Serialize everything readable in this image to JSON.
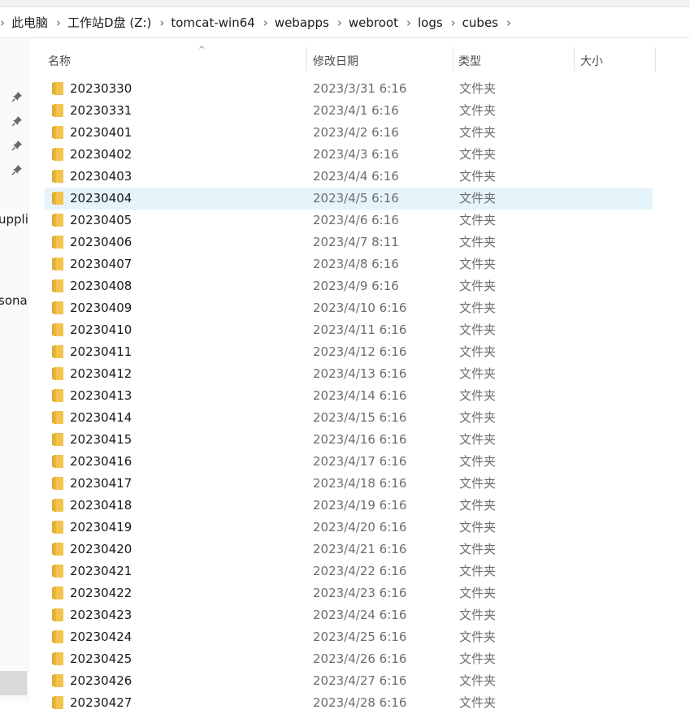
{
  "breadcrumb": [
    "此电脑",
    "工作站D盘 (Z:)",
    "tomcat-win64",
    "webapps",
    "webroot",
    "logs",
    "cubes"
  ],
  "nav_fragments": [
    "upplic",
    "sona"
  ],
  "columns": {
    "name": "名称",
    "modified": "修改日期",
    "type": "类型",
    "size": "大小"
  },
  "colors": {
    "selected_row": "#e5f3fb",
    "folder": "#f2c44e",
    "folder_dark": "#dfa92c"
  },
  "selected_index": 5,
  "files": [
    {
      "name": "20230330",
      "date": "2023/3/31 6:16",
      "type": "文件夹"
    },
    {
      "name": "20230331",
      "date": "2023/4/1 6:16",
      "type": "文件夹"
    },
    {
      "name": "20230401",
      "date": "2023/4/2 6:16",
      "type": "文件夹"
    },
    {
      "name": "20230402",
      "date": "2023/4/3 6:16",
      "type": "文件夹"
    },
    {
      "name": "20230403",
      "date": "2023/4/4 6:16",
      "type": "文件夹"
    },
    {
      "name": "20230404",
      "date": "2023/4/5 6:16",
      "type": "文件夹"
    },
    {
      "name": "20230405",
      "date": "2023/4/6 6:16",
      "type": "文件夹"
    },
    {
      "name": "20230406",
      "date": "2023/4/7 8:11",
      "type": "文件夹"
    },
    {
      "name": "20230407",
      "date": "2023/4/8 6:16",
      "type": "文件夹"
    },
    {
      "name": "20230408",
      "date": "2023/4/9 6:16",
      "type": "文件夹"
    },
    {
      "name": "20230409",
      "date": "2023/4/10 6:16",
      "type": "文件夹"
    },
    {
      "name": "20230410",
      "date": "2023/4/11 6:16",
      "type": "文件夹"
    },
    {
      "name": "20230411",
      "date": "2023/4/12 6:16",
      "type": "文件夹"
    },
    {
      "name": "20230412",
      "date": "2023/4/13 6:16",
      "type": "文件夹"
    },
    {
      "name": "20230413",
      "date": "2023/4/14 6:16",
      "type": "文件夹"
    },
    {
      "name": "20230414",
      "date": "2023/4/15 6:16",
      "type": "文件夹"
    },
    {
      "name": "20230415",
      "date": "2023/4/16 6:16",
      "type": "文件夹"
    },
    {
      "name": "20230416",
      "date": "2023/4/17 6:16",
      "type": "文件夹"
    },
    {
      "name": "20230417",
      "date": "2023/4/18 6:16",
      "type": "文件夹"
    },
    {
      "name": "20230418",
      "date": "2023/4/19 6:16",
      "type": "文件夹"
    },
    {
      "name": "20230419",
      "date": "2023/4/20 6:16",
      "type": "文件夹"
    },
    {
      "name": "20230420",
      "date": "2023/4/21 6:16",
      "type": "文件夹"
    },
    {
      "name": "20230421",
      "date": "2023/4/22 6:16",
      "type": "文件夹"
    },
    {
      "name": "20230422",
      "date": "2023/4/23 6:16",
      "type": "文件夹"
    },
    {
      "name": "20230423",
      "date": "2023/4/24 6:16",
      "type": "文件夹"
    },
    {
      "name": "20230424",
      "date": "2023/4/25 6:16",
      "type": "文件夹"
    },
    {
      "name": "20230425",
      "date": "2023/4/26 6:16",
      "type": "文件夹"
    },
    {
      "name": "20230426",
      "date": "2023/4/27 6:16",
      "type": "文件夹"
    },
    {
      "name": "20230427",
      "date": "2023/4/28 6:16",
      "type": "文件夹"
    }
  ]
}
